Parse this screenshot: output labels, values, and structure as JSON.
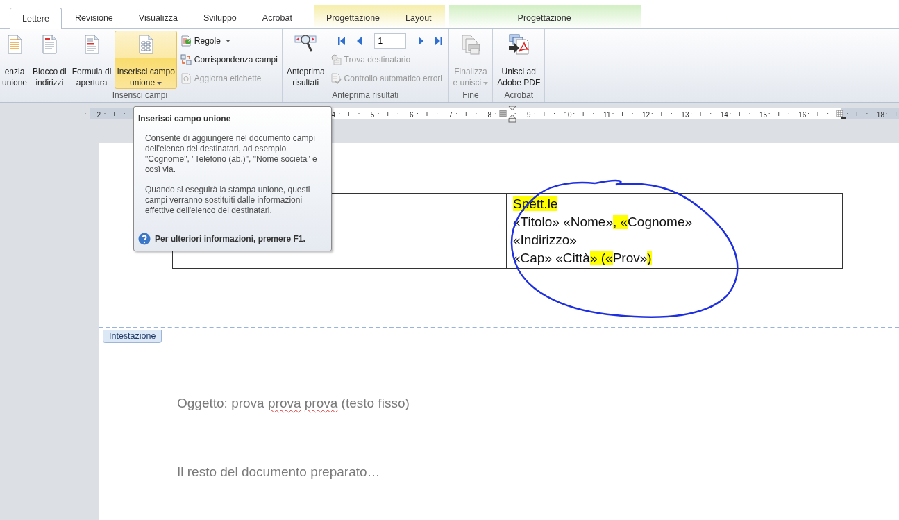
{
  "tabs": [
    {
      "label": "Lettere",
      "selected": true
    },
    {
      "label": "Revisione",
      "selected": false
    },
    {
      "label": "Visualizza",
      "selected": false
    },
    {
      "label": "Sviluppo",
      "selected": false
    },
    {
      "label": "Acrobat",
      "selected": false
    }
  ],
  "context_tabs": [
    {
      "color": "#f6efae",
      "tabs": [
        {
          "label": "Progettazione",
          "selected": false
        },
        {
          "label": "Layout",
          "selected": false
        }
      ]
    },
    {
      "color": "#d4f0c6",
      "tabs": [
        {
          "label": "Progettazione",
          "selected": false
        }
      ]
    }
  ],
  "ribbon": {
    "groups": [
      {
        "label": "Inserisci campi",
        "large": [
          {
            "label": "enzia\nunione",
            "dropdown": false,
            "disabled": false,
            "hovered": false
          },
          {
            "label": "Blocco di\nindirizzi",
            "dropdown": false,
            "disabled": false,
            "hovered": false
          },
          {
            "label": "Formula di\napertura",
            "dropdown": false,
            "disabled": false,
            "hovered": false
          },
          {
            "label": "Inserisci campo\nunione",
            "dropdown": true,
            "disabled": false,
            "hovered": true
          }
        ],
        "small": [
          {
            "kind": "button",
            "label": "Regole",
            "dropdown": true,
            "disabled": false
          },
          {
            "kind": "button",
            "label": "Corrispondenza campi",
            "dropdown": false,
            "disabled": false
          },
          {
            "kind": "button",
            "label": "Aggiorna etichette",
            "dropdown": false,
            "disabled": true
          }
        ]
      },
      {
        "label": "Anteprima risultati",
        "large": [
          {
            "label": "Anteprima\nrisultati",
            "dropdown": false,
            "disabled": false,
            "hovered": false
          }
        ],
        "small": [
          {
            "kind": "nav",
            "value": "1"
          },
          {
            "kind": "button",
            "label": "Trova destinatario",
            "dropdown": false,
            "disabled": true
          },
          {
            "kind": "button",
            "label": "Controllo automatico errori",
            "dropdown": false,
            "disabled": true
          }
        ]
      },
      {
        "label": "Fine",
        "large": [
          {
            "label": "Finalizza\ne unisci",
            "dropdown": true,
            "disabled": true,
            "hovered": false
          }
        ]
      },
      {
        "label": "Acrobat",
        "large": [
          {
            "label": "Unisci ad\nAdobe PDF",
            "dropdown": false,
            "disabled": false,
            "hovered": false
          }
        ]
      }
    ]
  },
  "ruler": {
    "left_labels": [
      "2"
    ],
    "right_labels": [
      "4",
      "5",
      "6",
      "7",
      "8",
      "9",
      "10",
      "11",
      "12",
      "13",
      "14",
      "15",
      "16"
    ],
    "far_labels": [
      "18"
    ]
  },
  "tooltip": {
    "title": "Inserisci campo unione",
    "paragraphs": [
      "Consente di aggiungere nel documento campi dell'elenco dei destinatari, ad esempio \"Cognome\", \"Telefono (ab.)\", \"Nome società\" e così via.",
      "Quando si eseguirà la stampa unione, questi campi verranno sostituiti dalle informazioni effettive dell'elenco dei destinatari."
    ],
    "help": "Per ulteriori informazioni, premere F1."
  },
  "document": {
    "address_lines": [
      [
        {
          "text": "Spett.le ",
          "highlighted": true
        }
      ],
      [
        {
          "text": "«Titolo» «Nome»",
          "highlighted": false
        },
        {
          "text": ", «",
          "highlighted": true
        },
        {
          "text": "Cognome»",
          "highlighted": false
        }
      ],
      [
        {
          "text": "«Indirizzo»",
          "highlighted": false
        }
      ],
      [
        {
          "text": "«Cap» «Città",
          "highlighted": false
        },
        {
          "text": "» («",
          "highlighted": true
        },
        {
          "text": "Prov»",
          "highlighted": false
        },
        {
          "text": ")",
          "highlighted": true
        }
      ]
    ],
    "header_label": "Intestazione",
    "paragraphs": [
      [
        {
          "text": "Oggetto: prova",
          "misspelled": false
        },
        {
          "text": "prova",
          "misspelled": true
        },
        {
          "text": "prova",
          "misspelled": true
        },
        {
          "text": "(testo fisso)",
          "misspelled": false
        }
      ],
      [
        {
          "text": "Il resto del documento preparato…",
          "misspelled": false
        }
      ]
    ]
  }
}
